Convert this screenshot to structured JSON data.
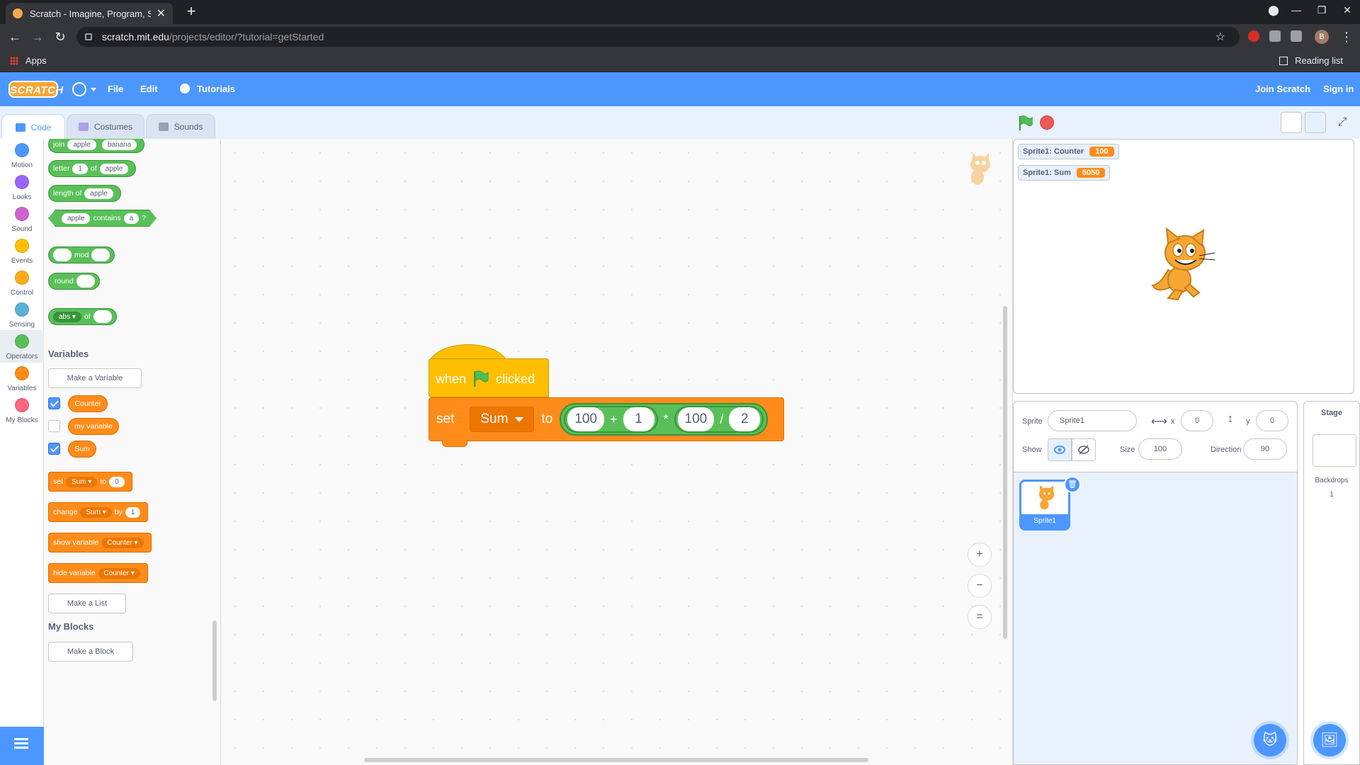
{
  "browser": {
    "tab_title": "Scratch - Imagine, Program, Shar",
    "tab_close": "✕",
    "new_tab": "+",
    "url_host": "scratch.mit.edu",
    "url_path": "/projects/editor/?tutorial=getStarted",
    "bookmarks_apps": "Apps",
    "reading_list": "Reading list",
    "profile_initial": "B"
  },
  "menubar": {
    "logo": "SCRATCH",
    "file": "File",
    "edit": "Edit",
    "tutorials": "Tutorials",
    "join": "Join Scratch",
    "signin": "Sign in"
  },
  "editor_tabs": {
    "code": "Code",
    "costumes": "Costumes",
    "sounds": "Sounds"
  },
  "categories": [
    {
      "label": "Motion",
      "color": "#4c97ff"
    },
    {
      "label": "Looks",
      "color": "#9966ff"
    },
    {
      "label": "Sound",
      "color": "#cf63cf"
    },
    {
      "label": "Events",
      "color": "#ffbf00"
    },
    {
      "label": "Control",
      "color": "#ffab19"
    },
    {
      "label": "Sensing",
      "color": "#5cb1d6"
    },
    {
      "label": "Operators",
      "color": "#59c059"
    },
    {
      "label": "Variables",
      "color": "#ff8c1a"
    },
    {
      "label": "My Blocks",
      "color": "#ff6680"
    }
  ],
  "palette": {
    "join": {
      "word": "join",
      "a": "apple",
      "b": "banana"
    },
    "letter": {
      "word": "letter",
      "n": "1",
      "of": "of",
      "s": "apple"
    },
    "length": {
      "word": "length of",
      "s": "apple"
    },
    "contains": {
      "a": "apple",
      "word": "contains",
      "b": "a",
      "q": "?"
    },
    "mod": "mod",
    "round": "round",
    "abs": {
      "fn": "abs ▾",
      "of": "of"
    },
    "variables_heading": "Variables",
    "make_variable": "Make a Variable",
    "vars": [
      {
        "name": "Counter",
        "checked": true
      },
      {
        "name": "my variable",
        "checked": false
      },
      {
        "name": "Sum",
        "checked": true
      }
    ],
    "set_blk": {
      "word": "set",
      "var": "Sum ▾",
      "to": "to",
      "val": "0"
    },
    "change_blk": {
      "word": "change",
      "var": "Sum ▾",
      "by": "by",
      "val": "1"
    },
    "show_blk": {
      "word": "show variable",
      "var": "Counter ▾"
    },
    "hide_blk": {
      "word": "hide variable",
      "var": "Counter ▾"
    },
    "make_list": "Make a List",
    "myblocks_heading": "My Blocks",
    "make_block": "Make a Block"
  },
  "script": {
    "hat_when": "when",
    "hat_clicked": "clicked",
    "set": "set",
    "var": "Sum",
    "to": "to",
    "n1": "100",
    "op1": "+",
    "n2": "1",
    "op2": "*",
    "n3": "100",
    "op3": "/",
    "n4": "2"
  },
  "zoom": {
    "in": "+",
    "out": "−",
    "reset": "="
  },
  "monitors": [
    {
      "label": "Sprite1: Counter",
      "value": "100"
    },
    {
      "label": "Sprite1: Sum",
      "value": "5050"
    }
  ],
  "sprite_info": {
    "sprite_label": "Sprite",
    "sprite_name": "Sprite1",
    "x_label": "x",
    "x": "0",
    "y_label": "y",
    "y": "0",
    "show_label": "Show",
    "size_label": "Size",
    "size": "100",
    "direction_label": "Direction",
    "direction": "90"
  },
  "sprite_thumb": "Sprite1",
  "stage_pane": {
    "title": "Stage",
    "backdrops_label": "Backdrops",
    "backdrops_count": "1"
  }
}
